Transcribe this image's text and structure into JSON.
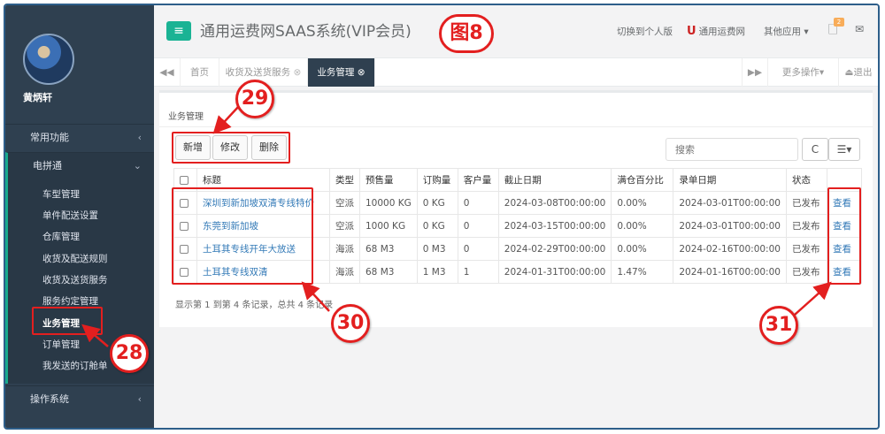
{
  "sidebar": {
    "user_name": "黄炳轩",
    "sections": [
      {
        "label": "常用功能",
        "chevron": "‹"
      },
      {
        "label": "电拼通",
        "chevron": "⌄"
      },
      {
        "label": "操作系统",
        "chevron": "‹"
      }
    ],
    "items": [
      "车型管理",
      "单件配送设置",
      "仓库管理",
      "收货及配送规则",
      "收货及送货服务",
      "服务约定管理",
      "业务管理",
      "订单管理",
      "我发送的订舱单"
    ],
    "accent": "#19aa8d"
  },
  "header": {
    "menu_icon": "≡",
    "title": "通用运费网SAAS系统(VIP会员)",
    "switch_personal": "切换到个人版",
    "brand_u": "U",
    "brand": "通用运费网",
    "other_apps": "其他应用",
    "notif_count": "2",
    "accent": "#1ab394"
  },
  "tabs": {
    "back": "◀◀",
    "home": "首页",
    "tab1": "收货及送货服务",
    "tab2": "业务管理",
    "forward": "▶▶",
    "more": "更多操作",
    "exit": "退出"
  },
  "panel": {
    "heading": "业务管理",
    "buttons": {
      "add": "新增",
      "edit": "修改",
      "delete": "删除"
    },
    "search_placeholder": "搜索",
    "refresh_icon": "C",
    "columns_icon": "☰▾"
  },
  "table": {
    "headers": [
      "标题",
      "类型",
      "预售量",
      "订购量",
      "客户量",
      "截止日期",
      "满仓百分比",
      "录单日期",
      "状态"
    ],
    "rows": [
      {
        "title": "深圳到新加坡双清专线特价",
        "type": "空派",
        "presale": "10000 KG",
        "ordered": "0 KG",
        "customers": "0",
        "deadline": "2024-03-08T00:00:00",
        "full_pct": "0.00%",
        "entry_date": "2024-03-01T00:00:00",
        "status": "已发布",
        "action": "查看"
      },
      {
        "title": "东莞到新加坡",
        "type": "空派",
        "presale": "1000 KG",
        "ordered": "0 KG",
        "customers": "0",
        "deadline": "2024-03-15T00:00:00",
        "full_pct": "0.00%",
        "entry_date": "2024-03-01T00:00:00",
        "status": "已发布",
        "action": "查看"
      },
      {
        "title": "土耳其专线开年大放送",
        "type": "海派",
        "presale": "68 M3",
        "ordered": "0 M3",
        "customers": "0",
        "deadline": "2024-02-29T00:00:00",
        "full_pct": "0.00%",
        "entry_date": "2024-02-16T00:00:00",
        "status": "已发布",
        "action": "查看"
      },
      {
        "title": "土耳其专线双清",
        "type": "海派",
        "presale": "68 M3",
        "ordered": "1 M3",
        "customers": "1",
        "deadline": "2024-01-31T00:00:00",
        "full_pct": "1.47%",
        "entry_date": "2024-01-16T00:00:00",
        "status": "已发布",
        "action": "查看"
      }
    ]
  },
  "pager_text": "显示第 1 到第 4 条记录，总共 4 条记录",
  "annotations": {
    "figure": "图8",
    "n28": "28",
    "n29": "29",
    "n30": "30",
    "n31": "31",
    "color": "#e31f1f"
  }
}
